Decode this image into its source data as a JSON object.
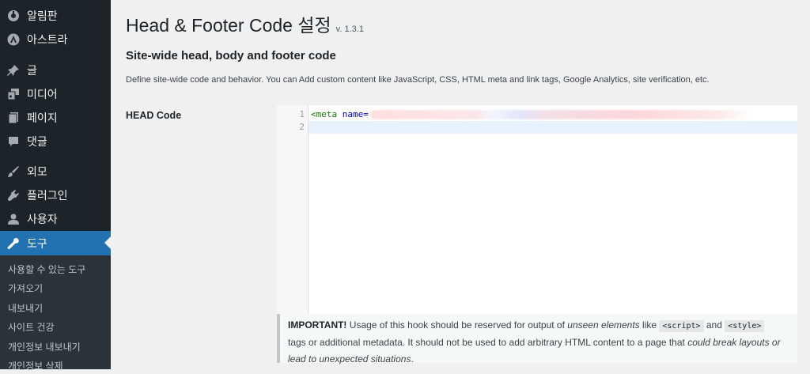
{
  "sidebar": {
    "items": [
      {
        "label": "알림판",
        "icon": "dashboard-icon"
      },
      {
        "label": "아스트라",
        "icon": "astra-icon"
      },
      {
        "label": "글",
        "icon": "pin-icon"
      },
      {
        "label": "미디어",
        "icon": "media-icon"
      },
      {
        "label": "페이지",
        "icon": "page-icon"
      },
      {
        "label": "댓글",
        "icon": "comment-icon"
      },
      {
        "label": "외모",
        "icon": "brush-icon"
      },
      {
        "label": "플러그인",
        "icon": "plugin-icon"
      },
      {
        "label": "사용자",
        "icon": "user-icon"
      },
      {
        "label": "도구",
        "icon": "wrench-icon",
        "active": true
      }
    ],
    "submenu": [
      "사용할 수 있는 도구",
      "가져오기",
      "내보내기",
      "사이트 건강",
      "개인정보 내보내기",
      "개인정보 삭제"
    ]
  },
  "page": {
    "title": "Head & Footer Code 설정",
    "version": "v. 1.3.1",
    "section_title": "Site-wide head, body and footer code",
    "description": "Define site-wide code and behavior. You can Add custom content like JavaScript, CSS, HTML meta and link tags, Google Analytics, site verification, etc.",
    "head_label": "HEAD Code"
  },
  "editor": {
    "line_numbers": [
      "1",
      "2"
    ],
    "line1_tag": "<meta",
    "line1_attr": "name="
  },
  "notice": {
    "important": "IMPORTANT!",
    "t1": " Usage of this hook should be reserved for output of ",
    "em1": "unseen elements",
    "t2": " like ",
    "code1": "<script>",
    "t3": " and ",
    "code2": "<style>",
    "t4": " tags or additional metadata. It should not be used to add arbitrary HTML content to a page that ",
    "em2": "could break layouts or lead to unexpected situations",
    "t5": "."
  },
  "colors": {
    "sidebar_bg": "#1d2327",
    "active_bg": "#2271b1",
    "page_bg": "#f0f0f1"
  }
}
